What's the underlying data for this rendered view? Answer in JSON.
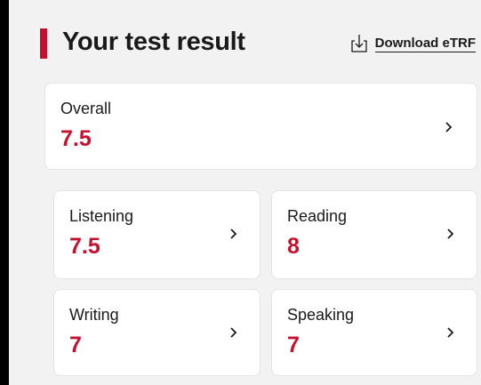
{
  "header": {
    "title": "Your test result",
    "download_label": "Download eTRF",
    "download_icon": "download-icon"
  },
  "colors": {
    "accent": "#c8102e",
    "page_background": "#f2f2f2",
    "card_background": "#ffffff",
    "text": "#1a1a1a"
  },
  "results": {
    "overall": {
      "label": "Overall",
      "score": "7.5"
    },
    "listening": {
      "label": "Listening",
      "score": "7.5"
    },
    "reading": {
      "label": "Reading",
      "score": "8"
    },
    "writing": {
      "label": "Writing",
      "score": "7"
    },
    "speaking": {
      "label": "Speaking",
      "score": "7"
    }
  },
  "icons": {
    "card_arrow": "chevron-right-icon"
  }
}
